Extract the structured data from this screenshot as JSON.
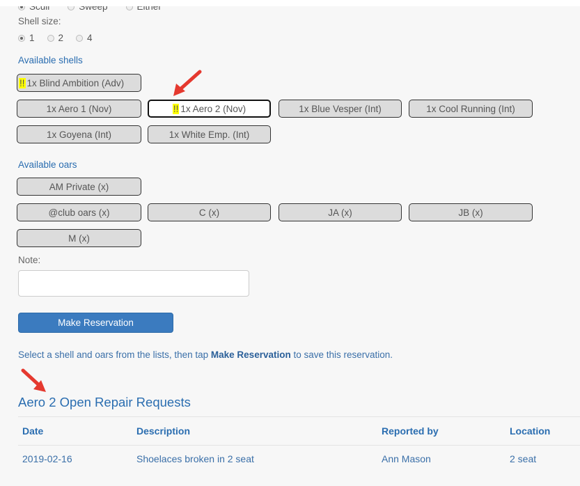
{
  "rig": {
    "options": [
      {
        "label": "Scull",
        "checked": true
      },
      {
        "label": "Sweep",
        "checked": false
      },
      {
        "label": "Either",
        "checked": false
      }
    ]
  },
  "shell_size": {
    "label": "Shell size:",
    "options": [
      {
        "label": "1",
        "checked": true
      },
      {
        "label": "2",
        "checked": false
      },
      {
        "label": "4",
        "checked": false
      }
    ]
  },
  "shells": {
    "title": "Available shells",
    "warning_mark": "!!",
    "items": [
      {
        "label": "1x Blind Ambition (Adv)",
        "flag": true,
        "selected": false
      },
      {
        "label": "1x Aero 1 (Nov)",
        "flag": false,
        "selected": false
      },
      {
        "label": "1x Aero 2 (Nov)",
        "flag": true,
        "selected": true
      },
      {
        "label": "1x Blue Vesper (Int)",
        "flag": false,
        "selected": false
      },
      {
        "label": "1x Cool Running (Int)",
        "flag": false,
        "selected": false
      },
      {
        "label": "1x Goyena (Int)",
        "flag": false,
        "selected": false
      },
      {
        "label": "1x White Emp. (Int)",
        "flag": false,
        "selected": false
      }
    ]
  },
  "oars": {
    "title": "Available oars",
    "items": [
      {
        "label": "AM Private (x)"
      },
      {
        "label": "@club oars (x)"
      },
      {
        "label": "C (x)"
      },
      {
        "label": "JA (x)"
      },
      {
        "label": "JB (x)"
      },
      {
        "label": "M (x)"
      }
    ]
  },
  "note": {
    "label": "Note:",
    "value": ""
  },
  "make_reservation": "Make Reservation",
  "help": {
    "before": "Select a shell and oars from the lists, then tap ",
    "bold": "Make Reservation",
    "after": " to save this reservation."
  },
  "repairs": {
    "title": "Aero 2 Open Repair Requests",
    "columns": [
      "Date",
      "Description",
      "Reported by",
      "Location"
    ],
    "rows": [
      [
        "2019-02-16",
        "Shoelaces broken in 2 seat",
        "Ann Mason",
        "2 seat"
      ]
    ]
  },
  "colors": {
    "accent": "#2a6db0",
    "button": "#3b7bbf",
    "highlight": "#ffff00",
    "annotation_arrow": "#e5392f"
  }
}
